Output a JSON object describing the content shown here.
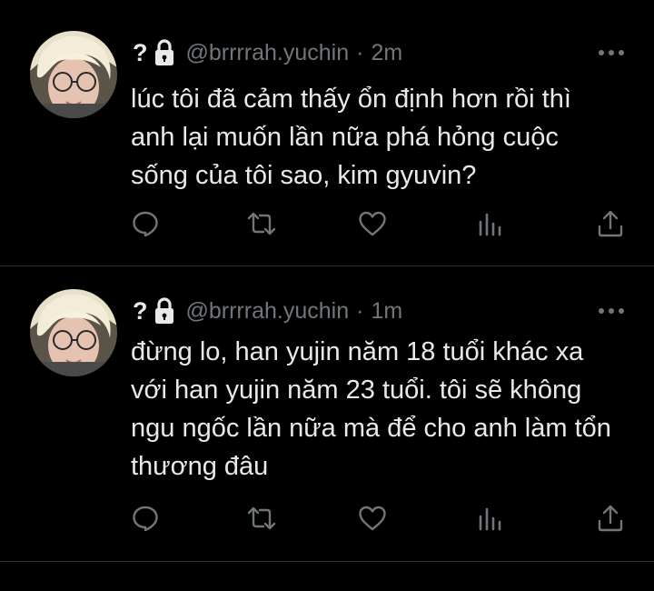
{
  "theme": {
    "background": "#000000",
    "text": "#e7e9ea",
    "muted": "#71767b",
    "divider": "#2f3336"
  },
  "tweets": [
    {
      "display_name": "?",
      "handle": "@brrrrah.yuchin",
      "separator": "·",
      "time": "2m",
      "text": "lúc tôi đã cảm thấy ổn định hơn rồi thì\nanh lại muốn lần nữa phá hỏng cuộc\nsống của tôi sao, kim gyuvin?",
      "icons": [
        "lock-icon",
        "more-icon",
        "reply-icon",
        "retweet-icon",
        "like-icon",
        "views-icon",
        "share-icon"
      ]
    },
    {
      "display_name": "?",
      "handle": "@brrrrah.yuchin",
      "separator": "·",
      "time": "1m",
      "text": "đừng lo, han yujin năm 18 tuổi khác xa\nvới han yujin năm 23 tuổi. tôi sẽ không\nngu ngốc lần nữa mà để cho anh làm tổn\nthương đâu",
      "icons": [
        "lock-icon",
        "more-icon",
        "reply-icon",
        "retweet-icon",
        "like-icon",
        "views-icon",
        "share-icon"
      ]
    }
  ]
}
